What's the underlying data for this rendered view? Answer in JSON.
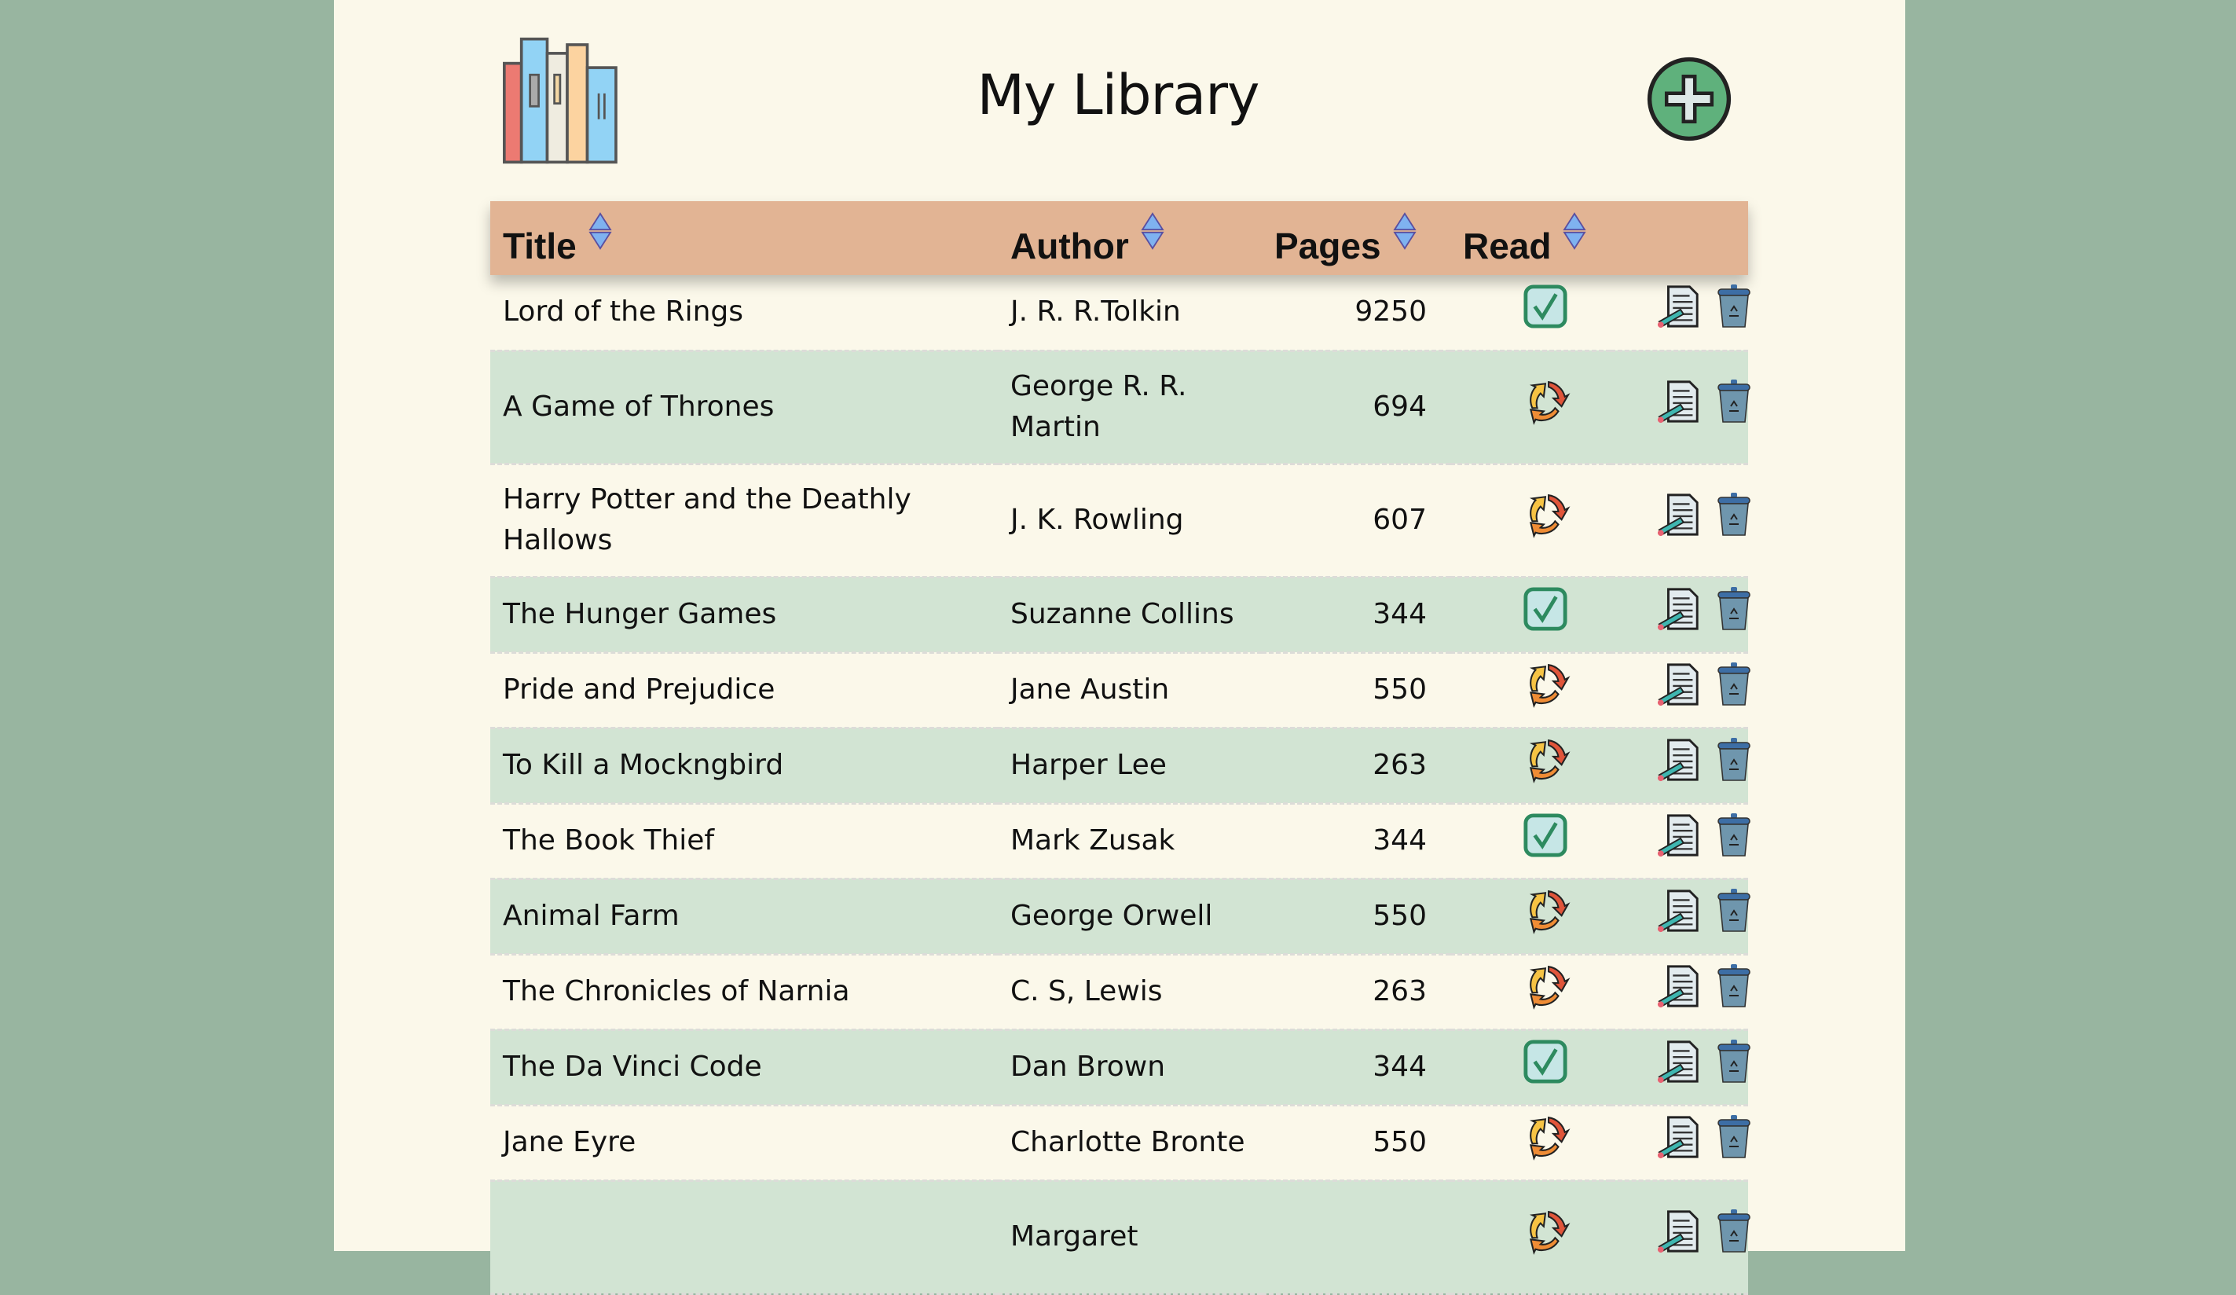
{
  "header": {
    "title": "My Library",
    "logo_icon": "books-icon",
    "add_icon": "plus-circle-icon"
  },
  "colors": {
    "background": "#98b5a0",
    "panel": "#fbf8ea",
    "header_row": "#e2b494",
    "alt_row": "#d2e4d3",
    "add_button": "#5fb17c"
  },
  "columns": [
    "Title",
    "Author",
    "Pages",
    "Read"
  ],
  "books": [
    {
      "title": "Lord of the Rings",
      "author": "J. R. R.Tolkin",
      "pages": "9250",
      "read": true
    },
    {
      "title": "A Game of Thrones",
      "author": "George R. R. Martin",
      "pages": "694",
      "read": false
    },
    {
      "title": "Harry Potter and the Deathly Hallows",
      "author": "J. K. Rowling",
      "pages": "607",
      "read": false
    },
    {
      "title": "The Hunger Games",
      "author": "Suzanne Collins",
      "pages": "344",
      "read": true
    },
    {
      "title": "Pride and Prejudice",
      "author": "Jane Austin",
      "pages": "550",
      "read": false
    },
    {
      "title": "To Kill a Mockngbird",
      "author": "Harper Lee",
      "pages": "263",
      "read": false
    },
    {
      "title": "The Book Thief",
      "author": "Mark Zusak",
      "pages": "344",
      "read": true
    },
    {
      "title": "Animal Farm",
      "author": "George Orwell",
      "pages": "550",
      "read": false
    },
    {
      "title": "The Chronicles of Narnia",
      "author": "C. S, Lewis",
      "pages": "263",
      "read": false
    },
    {
      "title": "The Da Vinci Code",
      "author": "Dan Brown",
      "pages": "344",
      "read": true
    },
    {
      "title": "Jane Eyre",
      "author": "Charlotte Bronte",
      "pages": "550",
      "read": false
    },
    {
      "title": "",
      "author": "Margaret",
      "pages": "",
      "read": false
    }
  ]
}
